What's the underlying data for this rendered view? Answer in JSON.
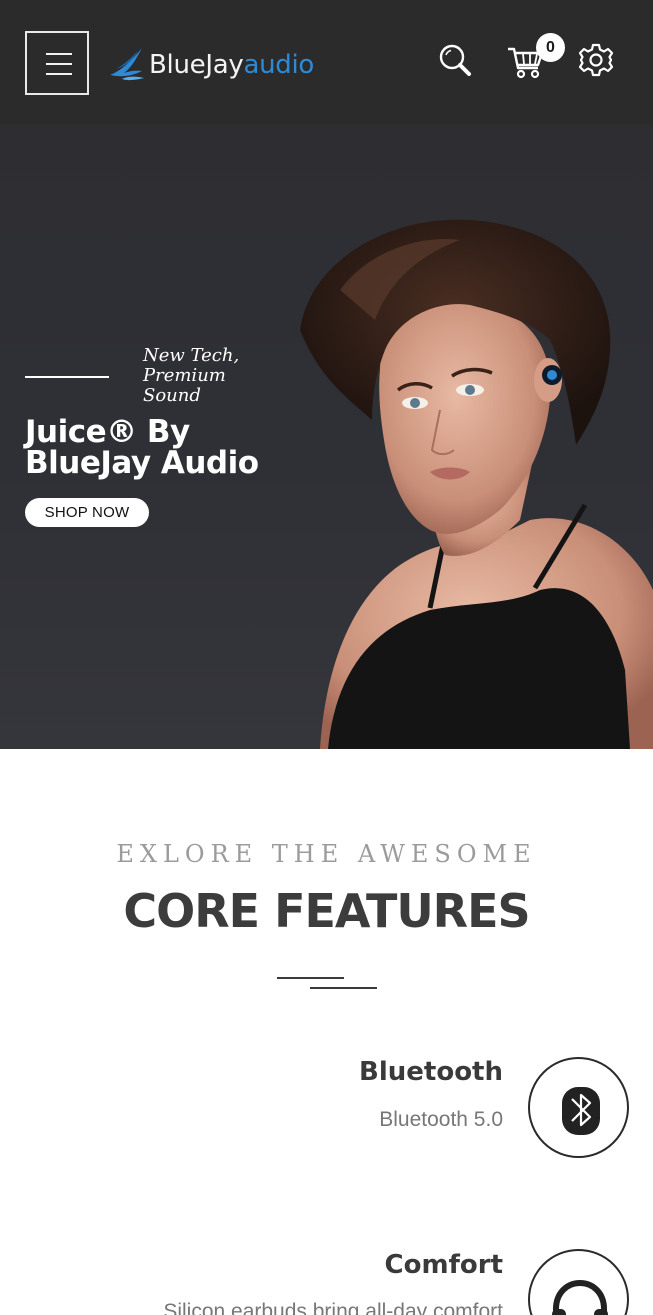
{
  "header": {
    "logo_blue": "BlueJay",
    "logo_audio": "audio",
    "cart_count": "0",
    "icons": [
      "menu-icon",
      "search-icon",
      "cart-icon",
      "gear-icon"
    ]
  },
  "hero": {
    "tagline": "New Tech, Premium Sound",
    "title": "Juice® By BlueJay Audio",
    "cta": "SHOP NOW"
  },
  "features": {
    "eyebrow": "EXLORE THE AWESOME",
    "title": "CORE FEATURES",
    "items": [
      {
        "title": "Bluetooth",
        "description": "Bluetooth 5.0",
        "icon": "bluetooth-icon"
      },
      {
        "title": "Comfort",
        "description": "Silicon earbuds bring all-day comfort",
        "icon": "headphones-icon"
      }
    ]
  },
  "colors": {
    "header_bg": "#2b2b2b",
    "hero_bg": "#2f3036",
    "brand_blue": "#2f8ad6",
    "heading_text": "#3c3c3c",
    "muted_text": "#9b9b9b"
  }
}
